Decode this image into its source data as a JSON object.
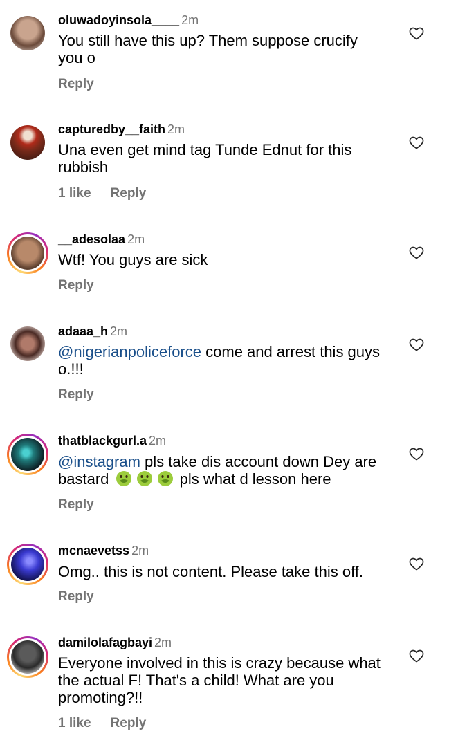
{
  "comments": [
    {
      "username": "oluwadoyinsola____",
      "time": "2m",
      "text": "You still have this up? Them suppose crucify you o",
      "likes": "",
      "reply": "Reply",
      "avatar_ring": false,
      "avatar_colors": [
        "#c9a48e",
        "#6b4a3a"
      ]
    },
    {
      "username": "capturedby__faith",
      "time": "2m",
      "text": "Una even get mind tag Tunde Ednut for this rubbish",
      "likes": "1 like",
      "reply": "Reply",
      "avatar_ring": false,
      "avatar_colors": [
        "#7a2a1a",
        "#2a1510"
      ]
    },
    {
      "username": "__adesolaa",
      "time": "2m",
      "text": "Wtf! You guys are sick",
      "likes": "",
      "reply": "Reply",
      "avatar_ring": true,
      "avatar_colors": [
        "#b8896a",
        "#5a3d2c"
      ]
    },
    {
      "username": "adaaa_h",
      "time": "2m",
      "mention": "@nigerianpoliceforce",
      "text": " come and arrest this guys o.!!!",
      "likes": "",
      "reply": "Reply",
      "avatar_ring": false,
      "avatar_colors": [
        "#d8c6c0",
        "#4a2a24"
      ]
    },
    {
      "username": "thatblackgurl.a",
      "time": "2m",
      "mention": "@instagram",
      "text": " pls take dis account down  Dey are bastard",
      "text_after": " pls what d lesson here",
      "emoji_count": 3,
      "likes": "",
      "reply": "Reply",
      "avatar_ring": true,
      "avatar_colors": [
        "#1f7a7a",
        "#0d1f24"
      ]
    },
    {
      "username": "mcnaevetss",
      "time": "2m",
      "text": "Omg.. this is not content. Please take this off.",
      "likes": "",
      "reply": "Reply",
      "avatar_ring": true,
      "avatar_colors": [
        "#3a3ad0",
        "#10104a"
      ]
    },
    {
      "username": "damilolafagbayi",
      "time": "2m",
      "text": "Everyone involved in this is crazy because what the actual F! That's a child! What are you promoting?!!",
      "likes": "1 like",
      "reply": "Reply",
      "avatar_ring": true,
      "avatar_colors": [
        "#8a8a8a",
        "#2a2a2a"
      ]
    }
  ],
  "colors": {
    "secondary_text": "#737373",
    "mention": "#1a4f8a",
    "heart_stroke": "#262626"
  },
  "icons": {
    "like": "heart-outline-icon",
    "emoji": "nauseated-face-emoji"
  }
}
